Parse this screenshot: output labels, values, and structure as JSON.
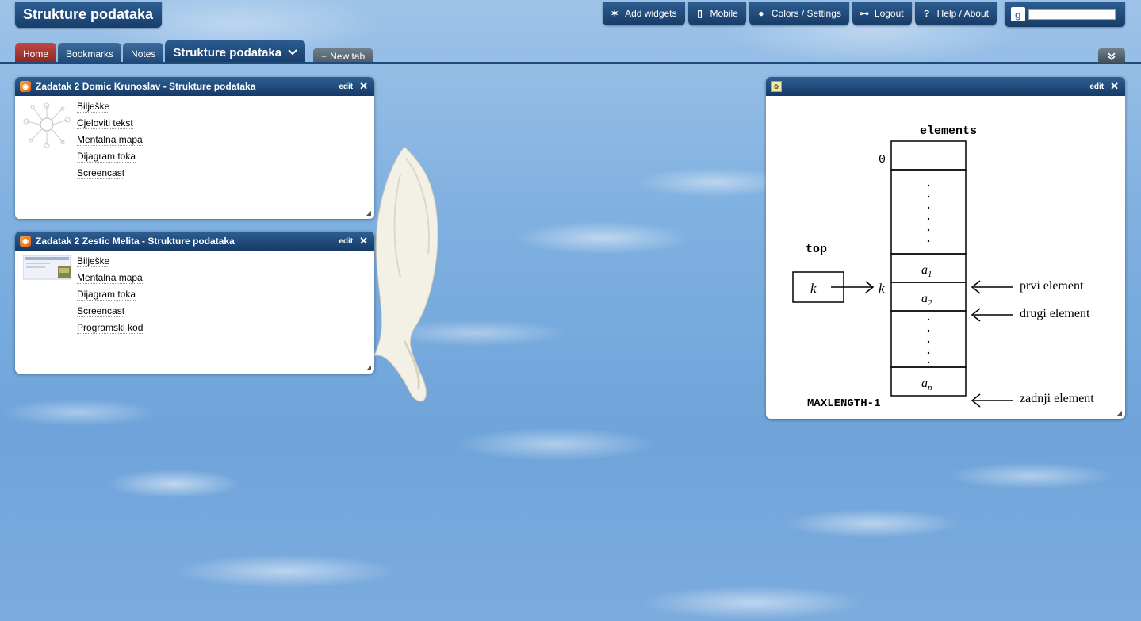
{
  "app": {
    "title": "Strukture podataka"
  },
  "toolbar": [
    {
      "label": "Add widgets",
      "icon": "add-widgets-icon",
      "glyph": "✶"
    },
    {
      "label": "Mobile",
      "icon": "mobile-icon",
      "glyph": "▯"
    },
    {
      "label": "Colors / Settings",
      "icon": "palette-icon",
      "glyph": "●"
    },
    {
      "label": "Logout",
      "icon": "key-icon",
      "glyph": "⊶"
    },
    {
      "label": "Help / About",
      "icon": "help-icon",
      "glyph": "?"
    }
  ],
  "search": {
    "placeholder": "",
    "value": ""
  },
  "tabs": {
    "items": [
      "Home",
      "Bookmarks",
      "Notes"
    ],
    "active": "Strukture podataka",
    "new_tab": "New tab"
  },
  "widgets": {
    "w1": {
      "title": "Zadatak 2 Domic Krunoslav - Strukture podataka",
      "edit": "edit",
      "links": [
        "Bilješke",
        "Cjeloviti tekst",
        "Mentalna mapa",
        "Dijagram toka",
        "Screencast"
      ]
    },
    "w2": {
      "title": "Zadatak 2 Zestic Melita - Strukture podataka",
      "edit": "edit",
      "links": [
        "Bilješke",
        "Mentalna mapa",
        "Dijagram toka",
        "Screencast",
        "Programski kod"
      ]
    },
    "w3": {
      "edit": "edit",
      "diagram": {
        "elements_label": "elements",
        "top_label": "top",
        "k": "k",
        "zero": "0",
        "maxlength": "MAXLENGTH-1",
        "a1": "a",
        "a1_sub": "1",
        "a2": "a",
        "a2_sub": "2",
        "an": "a",
        "an_sub": "n",
        "prvi": "prvi element",
        "drugi": "drugi element",
        "zadnji": "zadnji element"
      }
    }
  },
  "colors": {
    "header": "#1f4b7a",
    "home_tab": "#a8332e",
    "sky": "#7fb0e0"
  }
}
